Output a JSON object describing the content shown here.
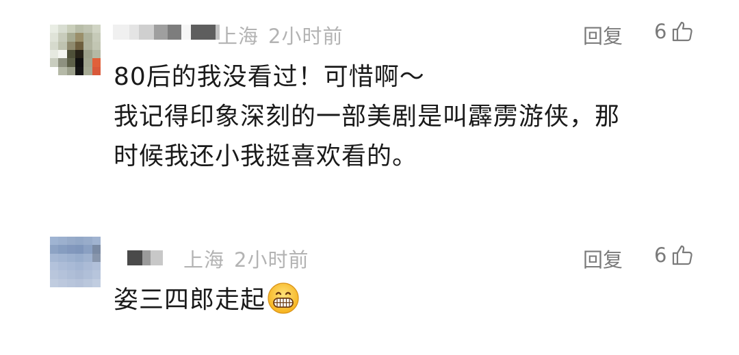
{
  "comments": [
    {
      "location": "上海",
      "time": "2小时前",
      "reply_label": "回复",
      "like_count": "6",
      "lines": [
        "80后的我没看过！可惜啊～",
        "我记得印象深刻的一部美剧是叫霹雳游侠，那",
        "时候我还小我挺喜欢看的。"
      ]
    },
    {
      "location": "上海",
      "time": "2小时前",
      "reply_label": "回复",
      "like_count": "6",
      "lines": [
        "姿三四郎走起"
      ],
      "emoji": "grinning-face-emoji"
    }
  ],
  "icons": {
    "like": "thumbs-up-icon"
  },
  "colors": {
    "meta_text": "#b3b3b3",
    "action_text": "#7a7a7a",
    "body_text": "#1a1a1a"
  }
}
